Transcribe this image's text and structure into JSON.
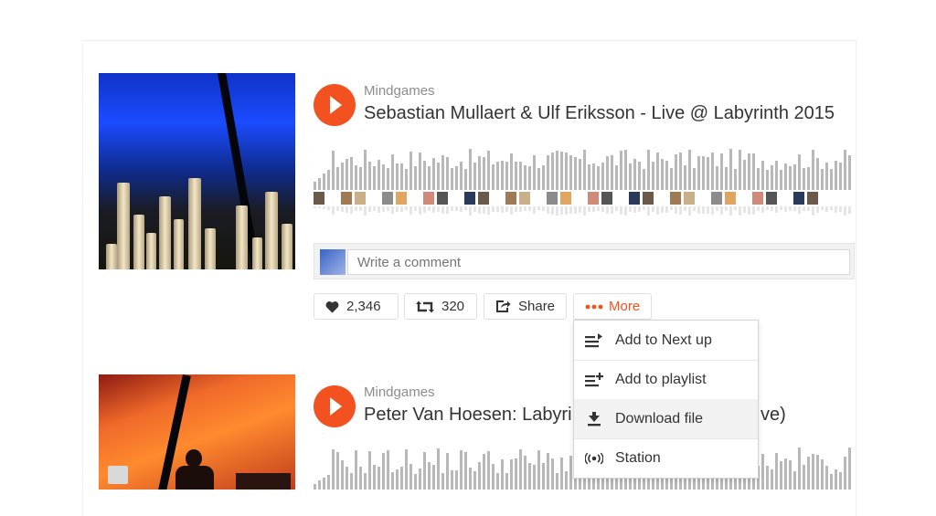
{
  "tracks": [
    {
      "user": "Mindgames",
      "title": "Sebastian Mullaert & Ulf Eriksson - Live @ Labyrinth 2015"
    },
    {
      "user": "Mindgames",
      "title_left": "Peter Van Hoesen: Labyri",
      "title_right": "ve)"
    }
  ],
  "comment": {
    "placeholder": "Write a comment"
  },
  "actions": {
    "likes": "2,346",
    "reposts": "320",
    "share": "Share",
    "more": "More"
  },
  "more_menu": [
    {
      "label": "Add to Next up",
      "icon": "next-up-icon"
    },
    {
      "label": "Add to playlist",
      "icon": "add-to-playlist-icon"
    },
    {
      "label": "Download file",
      "icon": "download-icon"
    },
    {
      "label": "Station",
      "icon": "station-icon"
    }
  ],
  "colors": {
    "accent": "#f2521f",
    "waveform": "#b8b8b8"
  }
}
